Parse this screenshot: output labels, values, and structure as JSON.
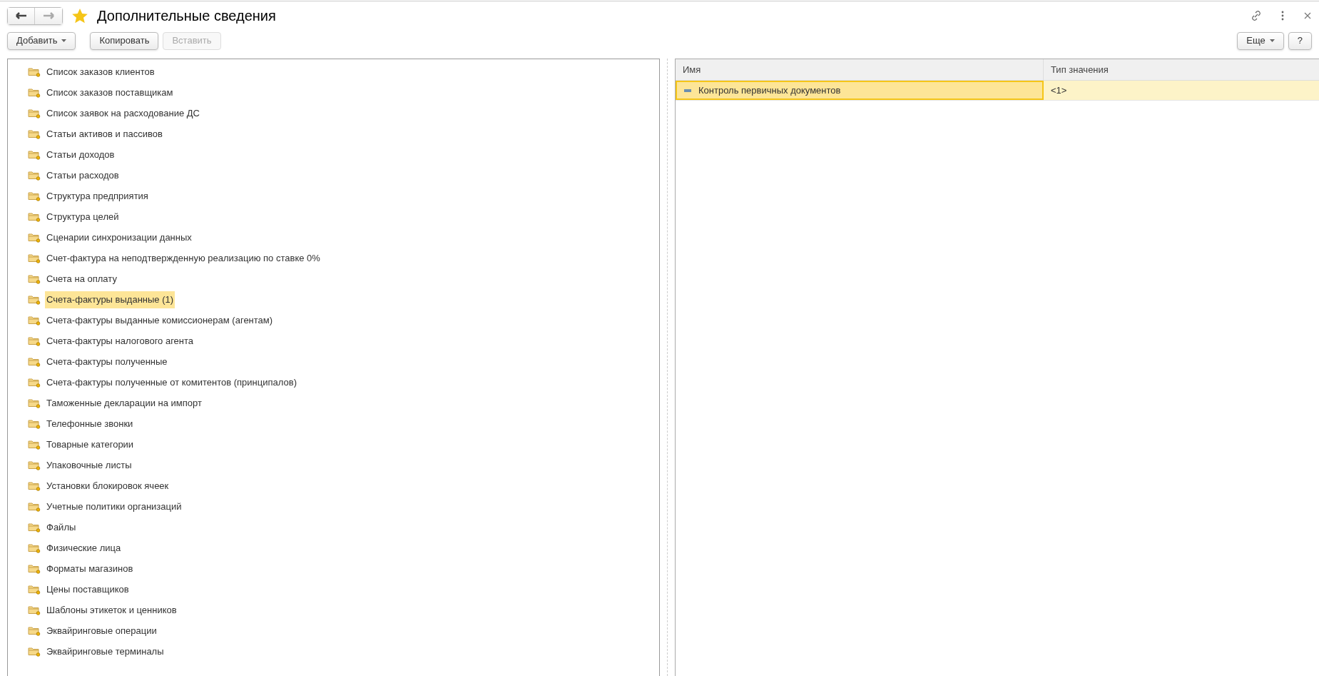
{
  "window": {
    "title": "Дополнительные сведения",
    "favorite": true
  },
  "nav": {
    "back_enabled": true,
    "forward_enabled": false
  },
  "toolbar": [
    {
      "label": "Добавить",
      "dropdown": true,
      "disabled": false
    },
    {
      "label": "Копировать",
      "dropdown": false,
      "disabled": false
    },
    {
      "label": "Вставить",
      "dropdown": false,
      "disabled": true
    }
  ],
  "toolbar_right": [
    {
      "label": "Еще",
      "dropdown": true
    },
    {
      "label": "?",
      "dropdown": false
    }
  ],
  "tree": {
    "items": [
      {
        "label": "Список заказов клиентов",
        "selected": false
      },
      {
        "label": "Список заказов поставщикам",
        "selected": false
      },
      {
        "label": "Список заявок на расходование ДС",
        "selected": false
      },
      {
        "label": "Статьи активов и пассивов",
        "selected": false
      },
      {
        "label": "Статьи доходов",
        "selected": false
      },
      {
        "label": "Статьи расходов",
        "selected": false
      },
      {
        "label": "Структура предприятия",
        "selected": false
      },
      {
        "label": "Структура целей",
        "selected": false
      },
      {
        "label": "Сценарии синхронизации данных",
        "selected": false
      },
      {
        "label": "Счет-фактура на неподтвержденную реализацию по ставке 0%",
        "selected": false
      },
      {
        "label": "Счета на оплату",
        "selected": false
      },
      {
        "label": "Счета-фактуры выданные (1)",
        "selected": true
      },
      {
        "label": "Счета-фактуры выданные комиссионерам (агентам)",
        "selected": false
      },
      {
        "label": "Счета-фактуры налогового агента",
        "selected": false
      },
      {
        "label": "Счета-фактуры полученные",
        "selected": false
      },
      {
        "label": "Счета-фактуры полученные от комитентов (принципалов)",
        "selected": false
      },
      {
        "label": "Таможенные декларации на импорт",
        "selected": false
      },
      {
        "label": "Телефонные звонки",
        "selected": false
      },
      {
        "label": "Товарные категории",
        "selected": false
      },
      {
        "label": "Упаковочные листы",
        "selected": false
      },
      {
        "label": "Установки блокировок ячеек",
        "selected": false
      },
      {
        "label": "Учетные политики организаций",
        "selected": false
      },
      {
        "label": "Файлы",
        "selected": false
      },
      {
        "label": "Физические лица",
        "selected": false
      },
      {
        "label": "Форматы магазинов",
        "selected": false
      },
      {
        "label": "Цены поставщиков",
        "selected": false
      },
      {
        "label": "Шаблоны этикеток и ценников",
        "selected": false
      },
      {
        "label": "Эквайринговые операции",
        "selected": false
      },
      {
        "label": "Эквайринговые терминалы",
        "selected": false
      }
    ]
  },
  "table": {
    "columns": [
      "Имя",
      "Тип значения"
    ],
    "rows": [
      {
        "name": "Контроль первичных документов",
        "type": "<1>",
        "selected": true
      }
    ]
  }
}
